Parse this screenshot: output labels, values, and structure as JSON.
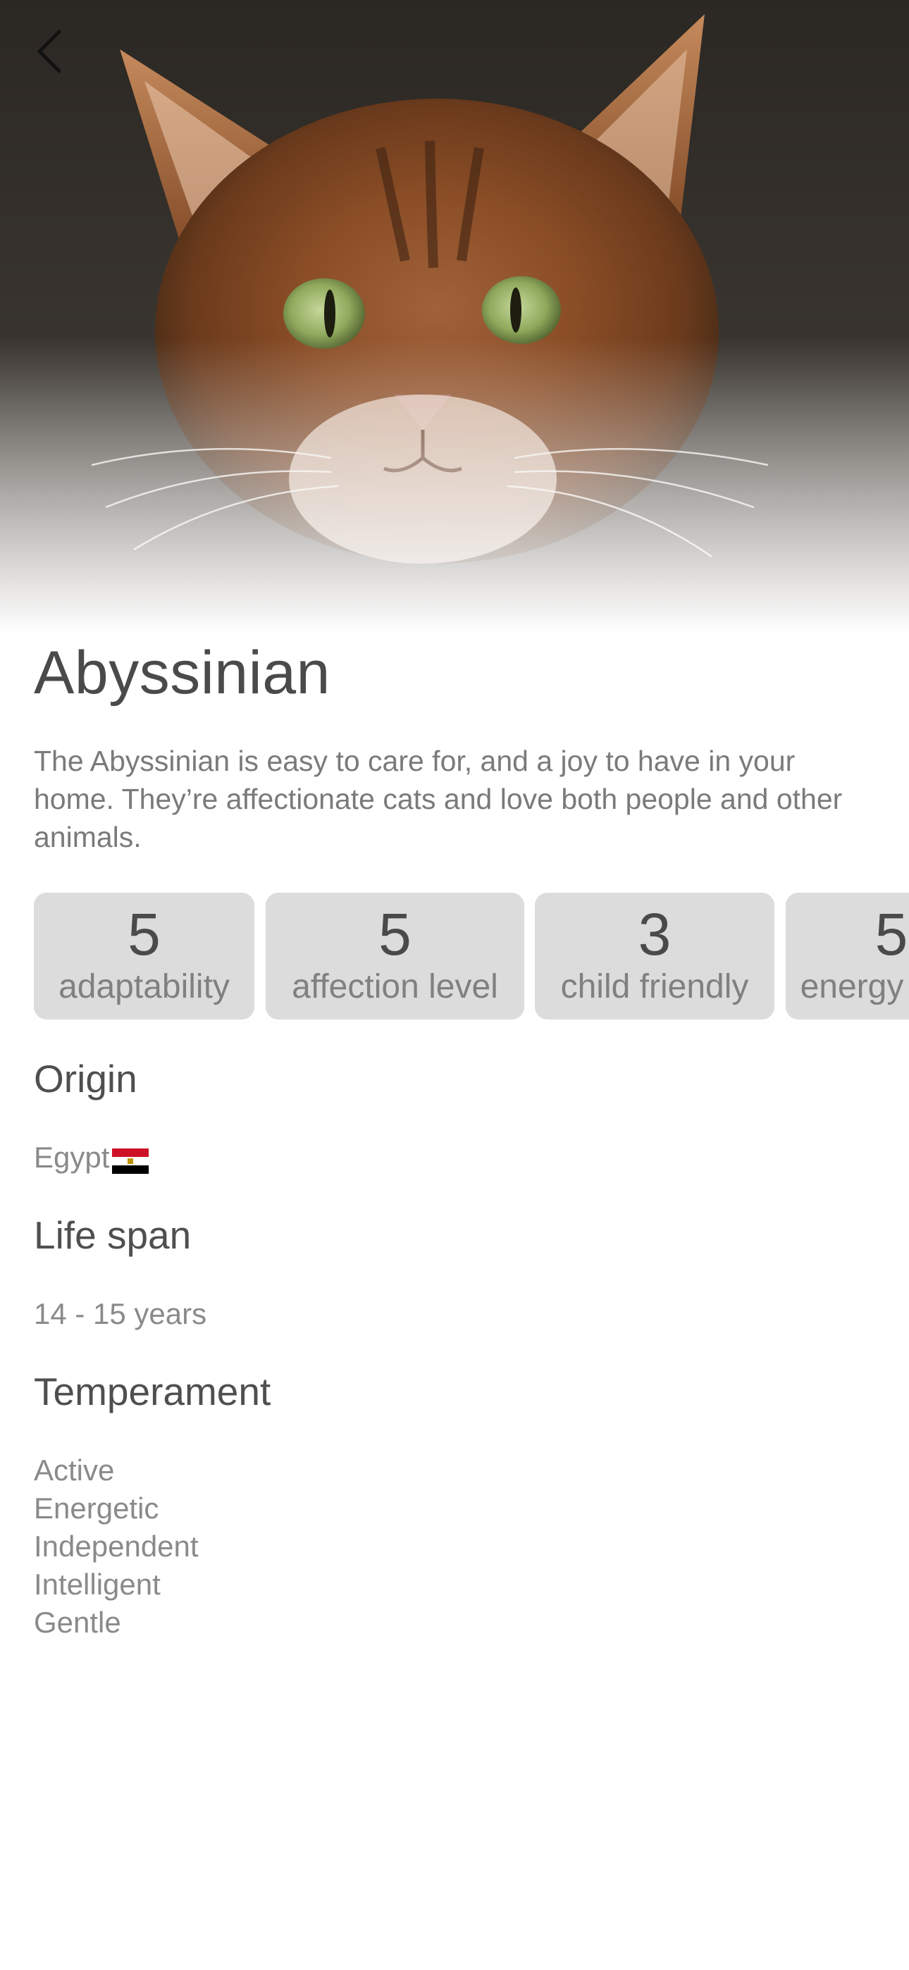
{
  "header": {
    "back_icon": "chevron-left-icon",
    "hero_image": "cat-photo"
  },
  "breed": {
    "name": "Abyssinian",
    "description": "The Abyssinian is easy to care for, and a joy to have in your home. They’re affectionate cats and love both people and other animals."
  },
  "stats": [
    {
      "value": "5",
      "label": "adaptability"
    },
    {
      "value": "5",
      "label": "affection level"
    },
    {
      "value": "3",
      "label": "child friendly"
    },
    {
      "value": "5",
      "label": "energy level"
    }
  ],
  "origin": {
    "heading": "Origin",
    "value": "Egypt",
    "flag_icon": "egypt-flag-icon"
  },
  "life_span": {
    "heading": "Life span",
    "value": "14 - 15 years"
  },
  "temperament": {
    "heading": "Temperament",
    "items": [
      "Active",
      "Energetic",
      "Independent",
      "Intelligent",
      "Gentle"
    ]
  },
  "colors": {
    "card_bg": "#dcdcdc",
    "title": "#4a4a4a",
    "secondary_text": "#8a8a8a"
  }
}
